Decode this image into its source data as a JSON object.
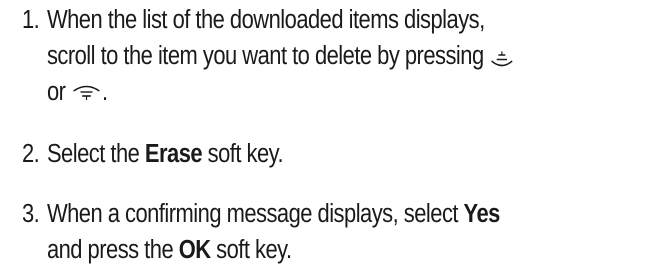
{
  "steps": [
    {
      "number": "1.",
      "line1": "When the list of the downloaded items displays,",
      "line2_before_icon": "scroll to the item you want to delete by pressing",
      "line3_before_icon": "or",
      "line3_after_icon": ".",
      "icons": [
        "scroll-up-key-icon",
        "scroll-down-key-icon"
      ]
    },
    {
      "number": "2.",
      "before": "Select the ",
      "bold": "Erase",
      "after": " soft key."
    },
    {
      "number": "3.",
      "line1_before": "When a confirming message displays, select ",
      "line1_bold": "Yes",
      "line2_before": "and press the ",
      "line2_bold": "OK",
      "line2_after": " soft key."
    }
  ]
}
